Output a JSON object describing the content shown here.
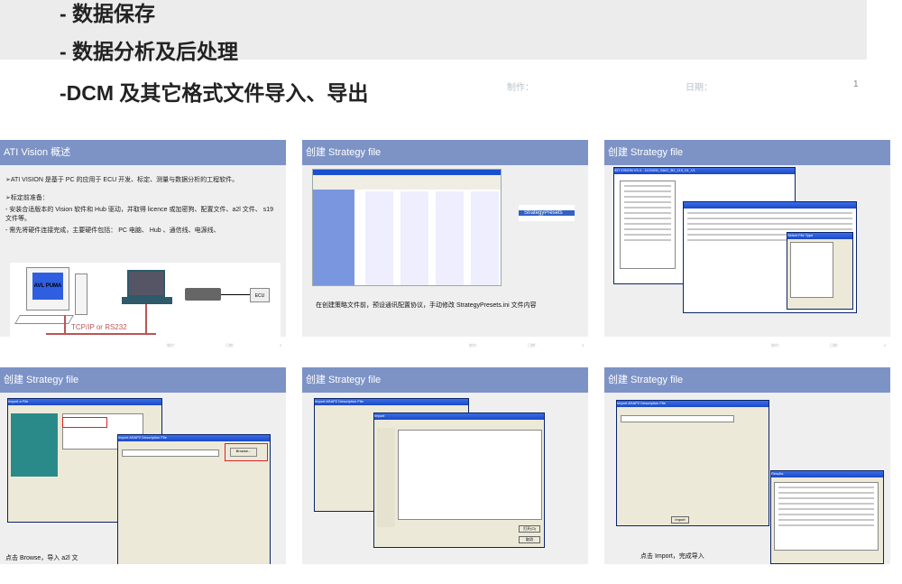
{
  "top_slide": {
    "bullets": [
      "- 数据保存",
      "- 数据分析及后处理",
      "-DCM 及其它格式文件导入、导出"
    ],
    "footer": {
      "author_label": "制作：",
      "date_label": "日期：",
      "page": "1"
    }
  },
  "slides": [
    {
      "title": "ATI Vision 概述",
      "page": "2",
      "paragraphs": [
        "➢ATI VISION  是基于 PC  的应用于 ECU  开发、标定、测量与数据分析的工程软件。",
        "➢标定前准备：",
        "  - 安装合适版本的 Vision 软件和 Hub 驱动，并取得 licence 或加密狗、配置文件、a2l 文件、 s19 文件等。",
        "  - 需先将硬件连接完成，主要硬件包括： PC 电脑、 Hub 、通信线、电源线、"
      ],
      "diagram": {
        "pc_label": "AVL PUMA",
        "ecu_label": "ECU",
        "link_label": "TCP/IP or RS232"
      }
    },
    {
      "title": "创建 Strategy file",
      "page": "3",
      "selected_file": "StrategyPresets",
      "caption": "在创建策略文件前，预设通讯配置协议，手动修改 StrategyPresets.ini 文件内容"
    },
    {
      "title": "创建 Strategy file",
      "page": "4",
      "window_title": "ATI VISION V3.4 - 1121000_SAIC_B2_110_01_V1",
      "dialog_title": "Select File Type"
    },
    {
      "title": "创建 Strategy file",
      "window_title": "Import a File",
      "dialog_title": "Import ASAP2 Description File",
      "browse_label": "Browse...",
      "caption": "点击 Browse，导入 a2l 文"
    },
    {
      "title": "创建 Strategy file",
      "window_title": "Import ASAP2 Description File",
      "dialog_title": "Import",
      "open_label": "打开(O)",
      "cancel_label": "取消"
    },
    {
      "title": "创建 Strategy file",
      "window_title": "Import ASAP2 Description File",
      "dialog_title": "Results",
      "import_label": "Import",
      "caption": "点击 Import，完成导入"
    }
  ],
  "footer_labels": {
    "author": "制作：",
    "date": "日期："
  }
}
